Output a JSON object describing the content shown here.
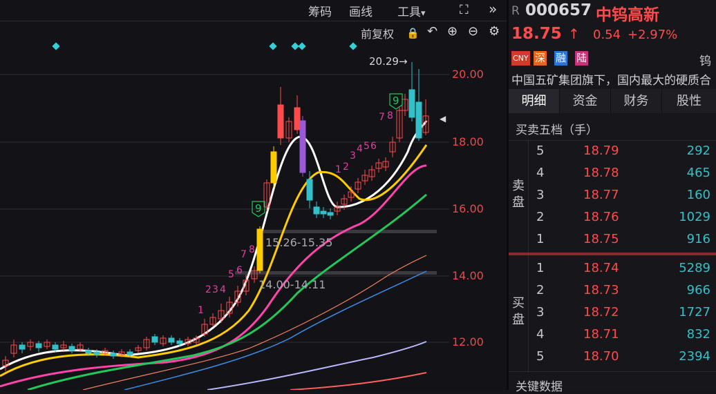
{
  "toolbar": {
    "chips_label": "筹码",
    "draw_label": "画线",
    "tools_label": "工具",
    "tools_arrow": "▾",
    "expand_icon": "⛶",
    "more_icon": "»"
  },
  "subtoolbar": {
    "adjust_label": "前复权",
    "lock_icon": "🔒",
    "undo_icon": "↶",
    "zoom_in_icon": "⊕",
    "zoom_out_icon": "⊖",
    "settings_icon": "⚙"
  },
  "chart_data": {
    "type": "candlestick",
    "y_ticks": [
      "20.00",
      "18.00",
      "16.00",
      "14.00",
      "12.00"
    ],
    "ylim": [
      11.2,
      20.9
    ],
    "high_annotation": "20.29→",
    "zone_labels": [
      "15.26-15.35",
      "14.00-14.11"
    ],
    "count_labels_up": [
      "1",
      "2",
      "3",
      "4",
      "5",
      "6",
      "7",
      "8"
    ],
    "count_labels_mid": [
      "1",
      "2",
      "3",
      "4",
      "5",
      "6",
      "7",
      "8"
    ],
    "nine_marks": [
      "9",
      "9"
    ],
    "current_price_marker": "◀"
  },
  "colors": {
    "up": "#ff4b4b",
    "down": "#33c0c8",
    "ma5": "#ffffff",
    "ma10": "#ffcc00",
    "ma20": "#ff44aa",
    "ma30": "#22c85a"
  },
  "quote": {
    "r_mark": "R",
    "code": "000657",
    "name": "中钨高新",
    "price": "18.75",
    "arrow": "↑",
    "change": "0.54",
    "change_pct": "+2.97%"
  },
  "tags": [
    "CNY",
    "深",
    "融",
    "陆"
  ],
  "tail_char": "钨",
  "description": "中国五矿集团旗下，国内最大的硬质合",
  "tabs": [
    "明细",
    "资金",
    "财务",
    "股性"
  ],
  "orderbook": {
    "title": "买卖五档（手）",
    "sell_label": "卖盘",
    "buy_label": "买盘",
    "sell": [
      {
        "level": "5",
        "price": "18.79",
        "vol": "292"
      },
      {
        "level": "4",
        "price": "18.78",
        "vol": "465"
      },
      {
        "level": "3",
        "price": "18.77",
        "vol": "160"
      },
      {
        "level": "2",
        "price": "18.76",
        "vol": "1029"
      },
      {
        "level": "1",
        "price": "18.75",
        "vol": "916"
      }
    ],
    "buy": [
      {
        "level": "1",
        "price": "18.74",
        "vol": "5289"
      },
      {
        "level": "2",
        "price": "18.73",
        "vol": "966"
      },
      {
        "level": "3",
        "price": "18.72",
        "vol": "1727"
      },
      {
        "level": "4",
        "price": "18.71",
        "vol": "832"
      },
      {
        "level": "5",
        "price": "18.70",
        "vol": "2394"
      }
    ]
  },
  "key_data_title": "关键数据"
}
